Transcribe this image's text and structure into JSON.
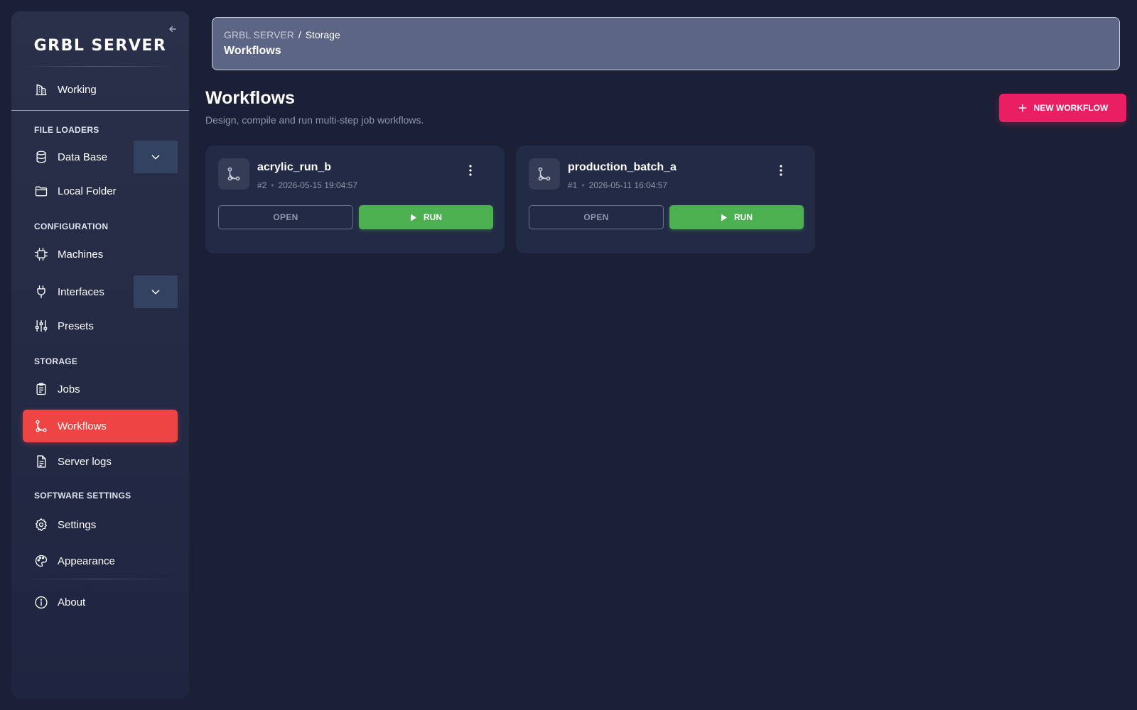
{
  "sidebar": {
    "brand": "GRBL SERVER",
    "items": {
      "working": "Working",
      "database": "Data Base",
      "local_folder": "Local Folder",
      "machines": "Machines",
      "interfaces": "Interfaces",
      "presets": "Presets",
      "jobs": "Jobs",
      "workflows": "Workflows",
      "server_logs": "Server logs",
      "settings": "Settings",
      "appearance": "Appearance",
      "about": "About"
    },
    "sections": {
      "file_loaders": "FILE LOADERS",
      "configuration": "CONFIGURATION",
      "storage": "STORAGE",
      "software_settings": "SOFTWARE SETTINGS"
    },
    "active_item": "workflows"
  },
  "breadcrumb": {
    "root": "GRBL SERVER",
    "separator": "/",
    "current": "Storage",
    "title": "Workflows"
  },
  "header": {
    "title": "Workflows",
    "subtitle": "Design, compile and run multi-step job workflows.",
    "new_button": "NEW WORKFLOW"
  },
  "workflows": [
    {
      "name": "acrylic_run_b",
      "id": "#2",
      "date": "2026-05-15 19:04:57",
      "open_label": "OPEN",
      "run_label": "RUN"
    },
    {
      "name": "production_batch_a",
      "id": "#1",
      "date": "2026-05-11 16:04:57",
      "open_label": "OPEN",
      "run_label": "RUN"
    }
  ],
  "colors": {
    "background": "#1b2036",
    "active_nav": "#ef4444",
    "new_button": "#e91e63",
    "run_button": "#4caf50",
    "card": "#232a45"
  },
  "icons": {
    "working": "building-icon",
    "database": "database-icon",
    "local_folder": "folder-icon",
    "machines": "chip-icon",
    "interfaces": "plug-icon",
    "presets": "sliders-icon",
    "jobs": "clipboard-icon",
    "workflows": "workflow-icon",
    "server_logs": "file-text-icon",
    "settings": "gear-icon",
    "appearance": "palette-icon",
    "about": "info-icon"
  }
}
